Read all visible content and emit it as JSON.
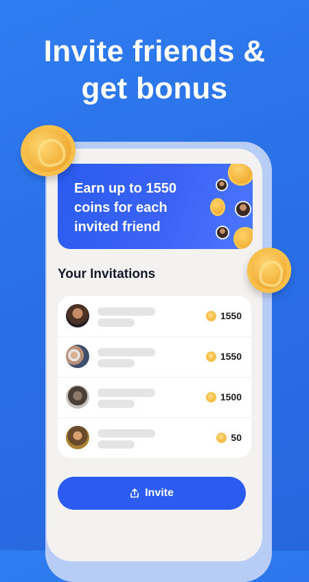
{
  "headline": {
    "line1": "Invite friends &",
    "line2": "get bonus"
  },
  "banner": {
    "text": "Earn up to 1550 coins for each invited friend"
  },
  "invitations": {
    "title": "Your Invitations",
    "rows": [
      {
        "avatar": "avatar-woman",
        "coins": "1550"
      },
      {
        "avatar": "avatar-couple",
        "coins": "1550"
      },
      {
        "avatar": "avatar-man",
        "coins": "1500"
      },
      {
        "avatar": "avatar-person",
        "coins": "50"
      }
    ]
  },
  "invite_button": {
    "label": "Invite",
    "icon": "share-icon"
  },
  "colors": {
    "background": "#2f7df0",
    "accent": "#2b5bf0",
    "coin": "#f4b33a"
  }
}
